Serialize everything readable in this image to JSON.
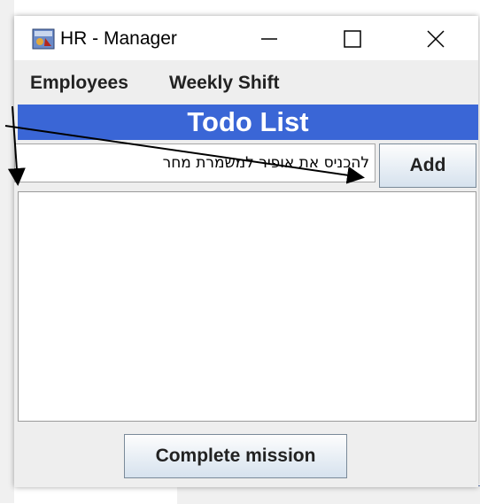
{
  "window": {
    "title": "HR - Manager",
    "icon": "java-app-icon",
    "controls": [
      "minimize-icon",
      "maximize-icon",
      "close-icon"
    ]
  },
  "menu": {
    "employees": "Employees",
    "weekly_shift": "Weekly Shift"
  },
  "todo": {
    "header": "Todo List",
    "input_value": "להכניס את אופיר למשמרת מחר",
    "add_label": "Add",
    "items": [],
    "complete_label": "Complete mission"
  },
  "colors": {
    "header_bg": "#3a66d6",
    "header_text": "#ffffff",
    "window_bg": "#eeeeee"
  },
  "annotations": {
    "arrow_color": "#000000",
    "icon": "arrow-icon"
  }
}
